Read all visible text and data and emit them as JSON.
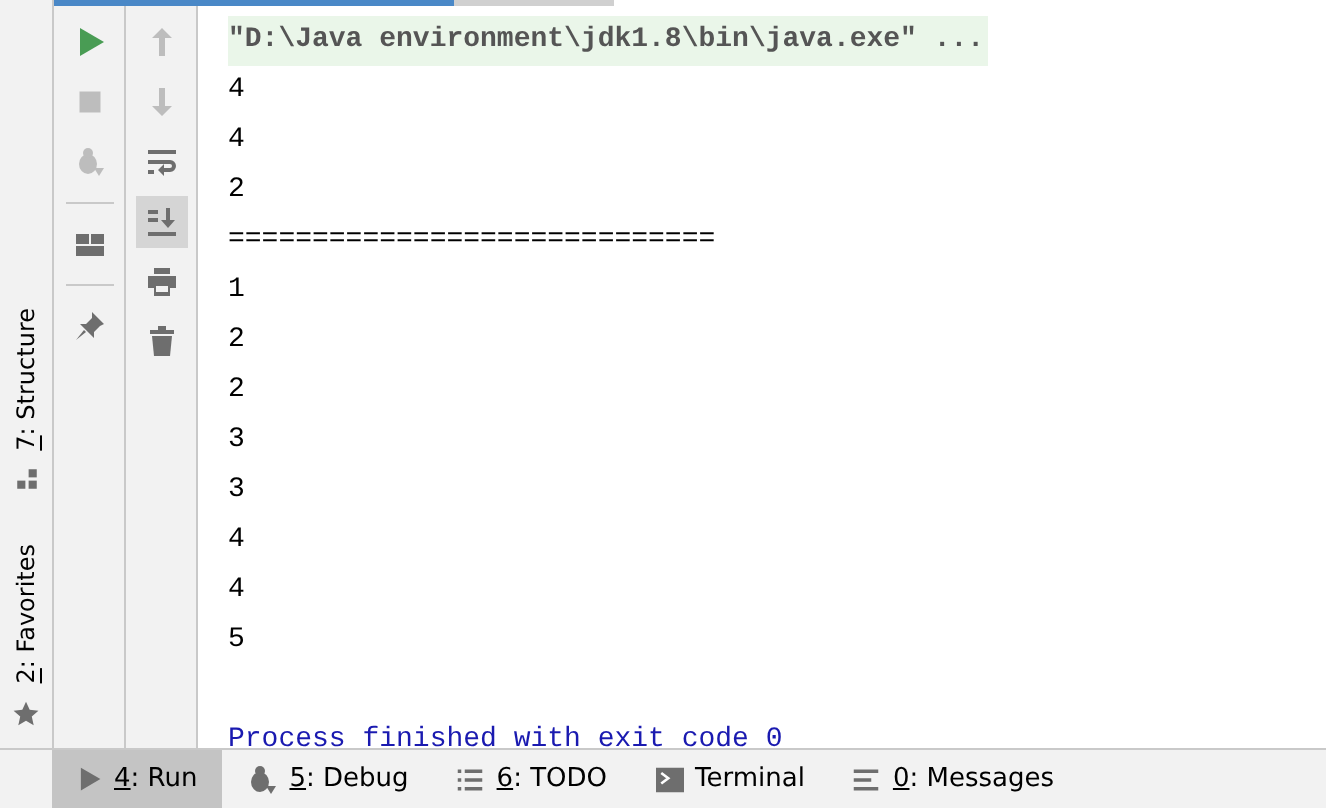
{
  "side_tabs": [
    {
      "mnemonic": "2",
      "label": ": Favorites",
      "kind": "star"
    },
    {
      "mnemonic": "7",
      "label": ": Structure",
      "kind": "structure"
    }
  ],
  "run_toolbar": [
    {
      "kind": "run",
      "disabled": false
    },
    {
      "kind": "stop",
      "disabled": true
    },
    {
      "kind": "debug",
      "disabled": true
    },
    {
      "kind": "separator"
    },
    {
      "kind": "layout",
      "disabled": false
    },
    {
      "kind": "separator"
    },
    {
      "kind": "pin",
      "disabled": false
    }
  ],
  "console_toolbar": [
    {
      "kind": "up",
      "disabled": true,
      "selected": false
    },
    {
      "kind": "down",
      "disabled": true,
      "selected": false
    },
    {
      "kind": "wrap",
      "disabled": false,
      "selected": false
    },
    {
      "kind": "scroll-end",
      "disabled": false,
      "selected": true
    },
    {
      "kind": "print",
      "disabled": false,
      "selected": false
    },
    {
      "kind": "trash",
      "disabled": false,
      "selected": false
    }
  ],
  "console": [
    {
      "kind": "command",
      "text": "\"D:\\Java environment\\jdk1.8\\bin\\java.exe\" ..."
    },
    {
      "kind": "output",
      "text": "4"
    },
    {
      "kind": "output",
      "text": "4"
    },
    {
      "kind": "output",
      "text": "2"
    },
    {
      "kind": "output",
      "text": "============================="
    },
    {
      "kind": "output",
      "text": "1"
    },
    {
      "kind": "output",
      "text": "2"
    },
    {
      "kind": "output",
      "text": "2"
    },
    {
      "kind": "output",
      "text": "3"
    },
    {
      "kind": "output",
      "text": "3"
    },
    {
      "kind": "output",
      "text": "4"
    },
    {
      "kind": "output",
      "text": "4"
    },
    {
      "kind": "output",
      "text": "5"
    },
    {
      "kind": "blank"
    },
    {
      "kind": "system",
      "text": "Process finished with exit code 0"
    }
  ],
  "bottom_tabs": [
    {
      "kind": "run",
      "mnemonic": "4",
      "label": ": Run",
      "selected": true
    },
    {
      "kind": "debug",
      "mnemonic": "5",
      "label": ": Debug",
      "selected": false
    },
    {
      "kind": "todo",
      "mnemonic": "6",
      "label": ": TODO",
      "selected": false
    },
    {
      "kind": "terminal",
      "label": "Terminal",
      "selected": false
    },
    {
      "kind": "messages",
      "mnemonic": "0",
      "label": ": Messages",
      "selected": false
    }
  ]
}
